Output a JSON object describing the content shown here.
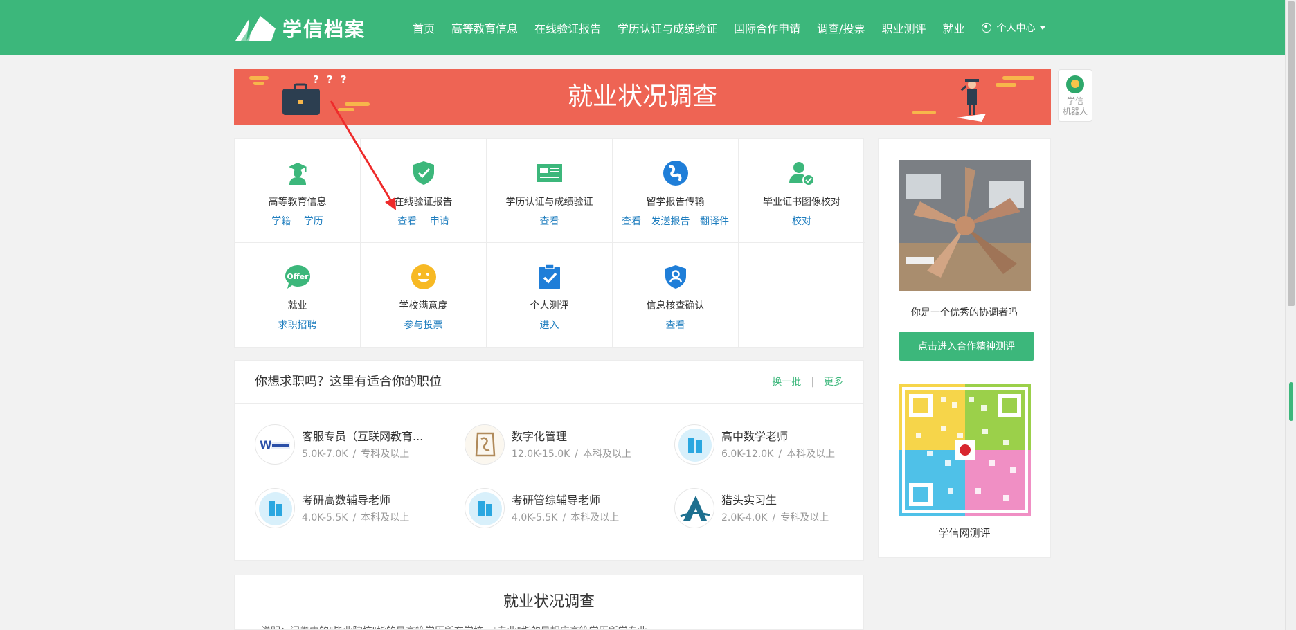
{
  "header": {
    "logo_text": "学信档案",
    "nav": [
      {
        "label": "首页"
      },
      {
        "label": "高等教育信息"
      },
      {
        "label": "在线验证报告"
      },
      {
        "label": "学历认证与成绩验证"
      },
      {
        "label": "国际合作申请"
      },
      {
        "label": "调查/投票"
      },
      {
        "label": "职业测评"
      },
      {
        "label": "就业"
      }
    ],
    "user_menu": "个人中心"
  },
  "banner": {
    "title": "就业状况调查",
    "marks": "? ? ?"
  },
  "robot": {
    "line1": "学信",
    "line2": "机器人"
  },
  "services": [
    {
      "name": "高等教育信息",
      "icon": "graduate-icon",
      "links": [
        "学籍",
        "学历"
      ]
    },
    {
      "name": "在线验证报告",
      "icon": "shield-check-icon",
      "links": [
        "查看",
        "申请"
      ]
    },
    {
      "name": "学历认证与成绩验证",
      "icon": "id-card-icon",
      "links": [
        "查看"
      ]
    },
    {
      "name": "留学报告传输",
      "icon": "globe-icon",
      "links": [
        "查看",
        "发送报告",
        "翻译件"
      ]
    },
    {
      "name": "毕业证书图像校对",
      "icon": "user-check-icon",
      "links": [
        "校对"
      ]
    },
    {
      "name": "就业",
      "icon": "offer-icon",
      "links": [
        "求职招聘"
      ]
    },
    {
      "name": "学校满意度",
      "icon": "smile-icon",
      "links": [
        "参与投票"
      ]
    },
    {
      "name": "个人测评",
      "icon": "clipboard-check-icon",
      "links": [
        "进入"
      ]
    },
    {
      "name": "信息核查确认",
      "icon": "shield-user-icon",
      "links": [
        "查看"
      ]
    }
  ],
  "offer_badge": "Offer",
  "jobs": {
    "title": "你想求职吗？这里有适合你的职位",
    "refresh": "换一批",
    "separator": "|",
    "more": "更多",
    "items": [
      {
        "title": "客服专员（互联网教育...",
        "salary": "5.0K-7.0K",
        "edu": "专科及以上",
        "logo": "company-logo-w"
      },
      {
        "title": "数字化管理",
        "salary": "12.0K-15.0K",
        "edu": "本科及以上",
        "logo": "company-logo-seal"
      },
      {
        "title": "高中数学老师",
        "salary": "6.0K-12.0K",
        "edu": "本科及以上",
        "logo": "building-icon"
      },
      {
        "title": "考研高数辅导老师",
        "salary": "4.0K-5.5K",
        "edu": "本科及以上",
        "logo": "building-icon"
      },
      {
        "title": "考研管综辅导老师",
        "salary": "4.0K-5.5K",
        "edu": "本科及以上",
        "logo": "building-icon"
      },
      {
        "title": "猎头实习生",
        "salary": "2.0K-4.0K",
        "edu": "专科及以上",
        "logo": "company-logo-a"
      }
    ]
  },
  "survey": {
    "title": "就业状况调查",
    "note": "说明：问卷中的\"毕业院校\"指的是高等学历所在学校，\"专业\"指的是相应高等学历所学专业"
  },
  "side": {
    "caption": "你是一个优秀的协调者吗",
    "cta": "点击进入合作精神测评",
    "qr_caption": "学信网测评"
  },
  "colors": {
    "brand_green": "#3cb77b",
    "banner_red": "#ee6454",
    "link_blue": "#1f7ebf",
    "icon_blue": "#1f7ed8",
    "accent_yellow": "#f7b64b"
  }
}
